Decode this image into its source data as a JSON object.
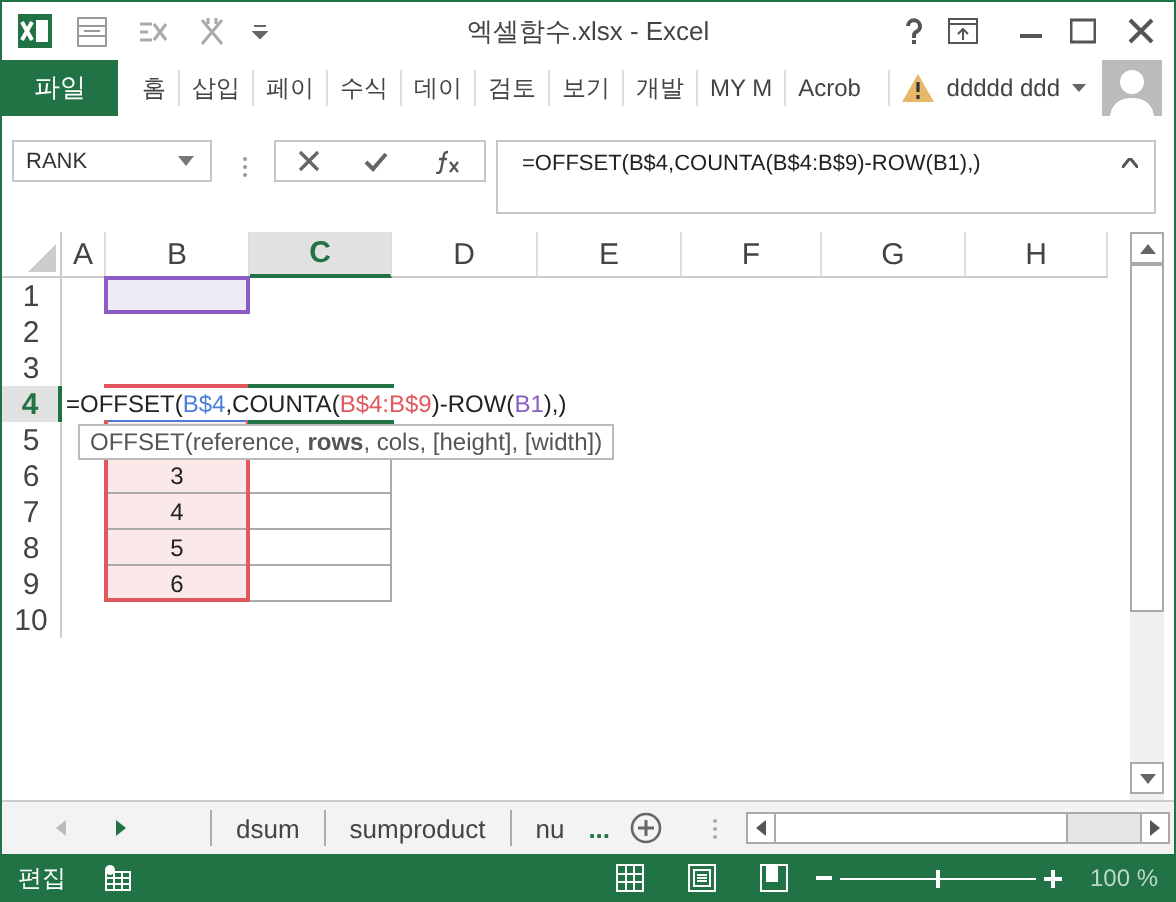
{
  "window": {
    "title": "엑셀함수.xlsx - Excel"
  },
  "ribbon_tabs": [
    {
      "label": "파일",
      "kind": "file"
    },
    {
      "label": "홈",
      "kind": "tab"
    },
    {
      "label": "삽입",
      "kind": "tab"
    },
    {
      "label": "페이",
      "kind": "tab"
    },
    {
      "label": "수식",
      "kind": "tab"
    },
    {
      "label": "데이",
      "kind": "tab"
    },
    {
      "label": "검토",
      "kind": "tab"
    },
    {
      "label": "보기",
      "kind": "tab"
    },
    {
      "label": "개발",
      "kind": "tab"
    },
    {
      "label": "MY M",
      "kind": "tab"
    },
    {
      "label": "Acrob",
      "kind": "tab"
    }
  ],
  "account": {
    "name": "ddddd ddd"
  },
  "name_box": {
    "value": "RANK"
  },
  "formula_bar": {
    "value": "=OFFSET(B$4,COUNTA(B$4:B$9)-ROW(B1),)"
  },
  "columns": [
    {
      "label": "A",
      "selected": false
    },
    {
      "label": "B",
      "selected": false
    },
    {
      "label": "C",
      "selected": true
    },
    {
      "label": "D",
      "selected": false
    },
    {
      "label": "E",
      "selected": false
    },
    {
      "label": "F",
      "selected": false
    },
    {
      "label": "G",
      "selected": false
    },
    {
      "label": "H",
      "selected": false
    }
  ],
  "rows": [
    {
      "label": "1",
      "selected": false
    },
    {
      "label": "2",
      "selected": false
    },
    {
      "label": "3",
      "selected": false
    },
    {
      "label": "4",
      "selected": true
    },
    {
      "label": "5",
      "selected": false
    },
    {
      "label": "6",
      "selected": false,
      "column_b": "3"
    },
    {
      "label": "7",
      "selected": false,
      "column_b": "4"
    },
    {
      "label": "8",
      "selected": false,
      "column_b": "5"
    },
    {
      "label": "9",
      "selected": false,
      "column_b": "6"
    },
    {
      "label": "10",
      "selected": false
    }
  ],
  "cell_editor": {
    "segments": [
      {
        "text": "=OFFSET("
      },
      {
        "text": "B$4",
        "color": "#4a7ed8"
      },
      {
        "text": ",COUNTA("
      },
      {
        "text": "B$4:B$9",
        "color": "#e0575e"
      },
      {
        "text": ")-ROW("
      },
      {
        "text": "B1",
        "color": "#8b5cc4"
      },
      {
        "text": "),)"
      }
    ]
  },
  "tooltip": {
    "text": "OFFSET(reference, **rows**, cols, [height], [width])"
  },
  "sheet_tabs": [
    {
      "label": "dsum"
    },
    {
      "label": "sumproduct"
    },
    {
      "label": "nu"
    }
  ],
  "more_sheets": "...",
  "status_bar": {
    "mode": "편집",
    "zoom": "100 %",
    "zoom_level": {
      "level": 0.5
    }
  }
}
